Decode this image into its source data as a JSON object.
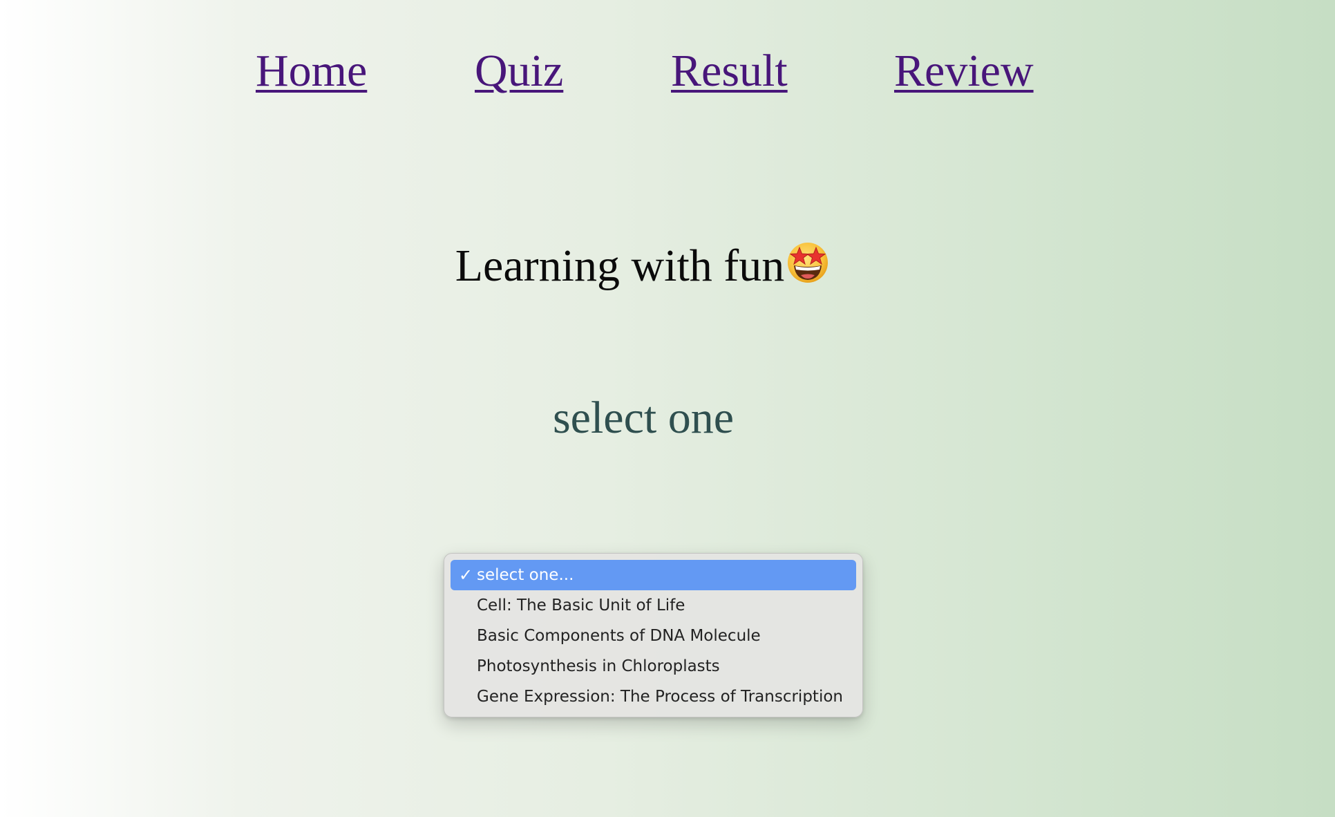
{
  "nav": {
    "links": [
      {
        "label": "Home"
      },
      {
        "label": "Quiz"
      },
      {
        "label": "Result"
      },
      {
        "label": "Review"
      }
    ]
  },
  "headline": {
    "text": "Learning with fun",
    "icon": "star-struck-emoji-icon"
  },
  "subhead": {
    "text": "select one"
  },
  "dropdown": {
    "selected_check": "✓",
    "options": [
      {
        "label": "select one..."
      },
      {
        "label": "Cell: The Basic Unit of Life"
      },
      {
        "label": "Basic Components of DNA Molecule"
      },
      {
        "label": "Photosynthesis in Chloroplasts"
      },
      {
        "label": "Gene Expression: The Process of Transcription"
      }
    ],
    "selected_index": 0,
    "highlight_color": "#6399f3"
  },
  "colors": {
    "link": "#48167a",
    "subhead": "#2f4f4f"
  }
}
